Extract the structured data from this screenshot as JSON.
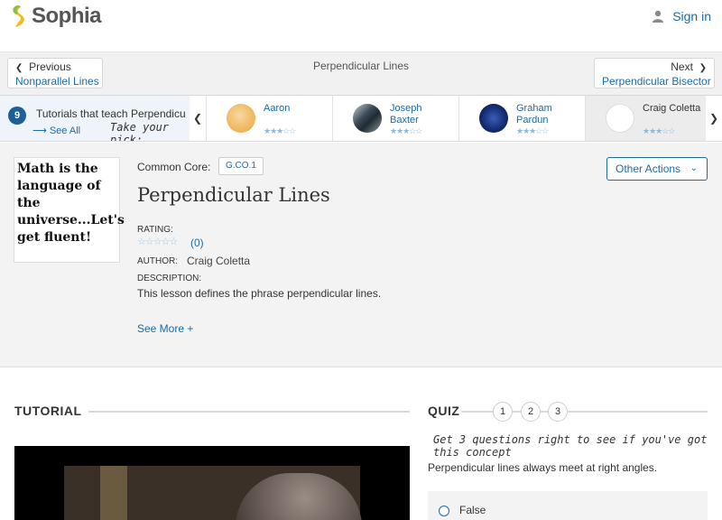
{
  "header": {
    "logo_text": "Sophia",
    "signin_label": "Sign in",
    "colors": {
      "logo_green": "#ffc20e",
      "link_blue": "#1c6aa5"
    }
  },
  "nav": {
    "prev_label": "Previous",
    "prev_link": "Nonparallel Lines",
    "title": "Perpendicular Lines",
    "next_label": "Next",
    "next_link": "Perpendicular Bisector"
  },
  "tutorials_strip": {
    "count": "9",
    "label": "Tutorials that teach Perpendicular Lines",
    "see_all": "See All",
    "pick_text": "Take your pick:",
    "items": [
      {
        "name": "Aaron",
        "stars": "★★★☆☆"
      },
      {
        "name": "Joseph Baxter",
        "stars": "★★★☆☆"
      },
      {
        "name": "Graham Pardun",
        "stars": "★★★☆☆"
      },
      {
        "name": "Craig Coletta",
        "stars": "★★★☆☆"
      }
    ]
  },
  "lesson": {
    "thumb_text": "Math is the language of the universe...Let's get fluent!",
    "common_core_label": "Common Core:",
    "common_core_code": "G.CO.1",
    "title": "Perpendicular Lines",
    "rating_label": "RATING:",
    "rating_stars": "☆☆☆☆☆",
    "rating_count": "(0)",
    "author_label": "AUTHOR:",
    "author_name": "Craig Coletta",
    "description_label": "DESCRIPTION:",
    "description": "This lesson defines the phrase perpendicular lines.",
    "see_more": "See More +",
    "other_actions": "Other Actions"
  },
  "tutorial": {
    "heading": "TUTORIAL"
  },
  "quiz": {
    "heading": "QUIZ",
    "numbers": [
      "1",
      "2",
      "3"
    ],
    "hint": "Get 3 questions right to see if you've got this concept",
    "question": "Perpendicular lines always meet at right angles.",
    "answer_first": "False"
  }
}
